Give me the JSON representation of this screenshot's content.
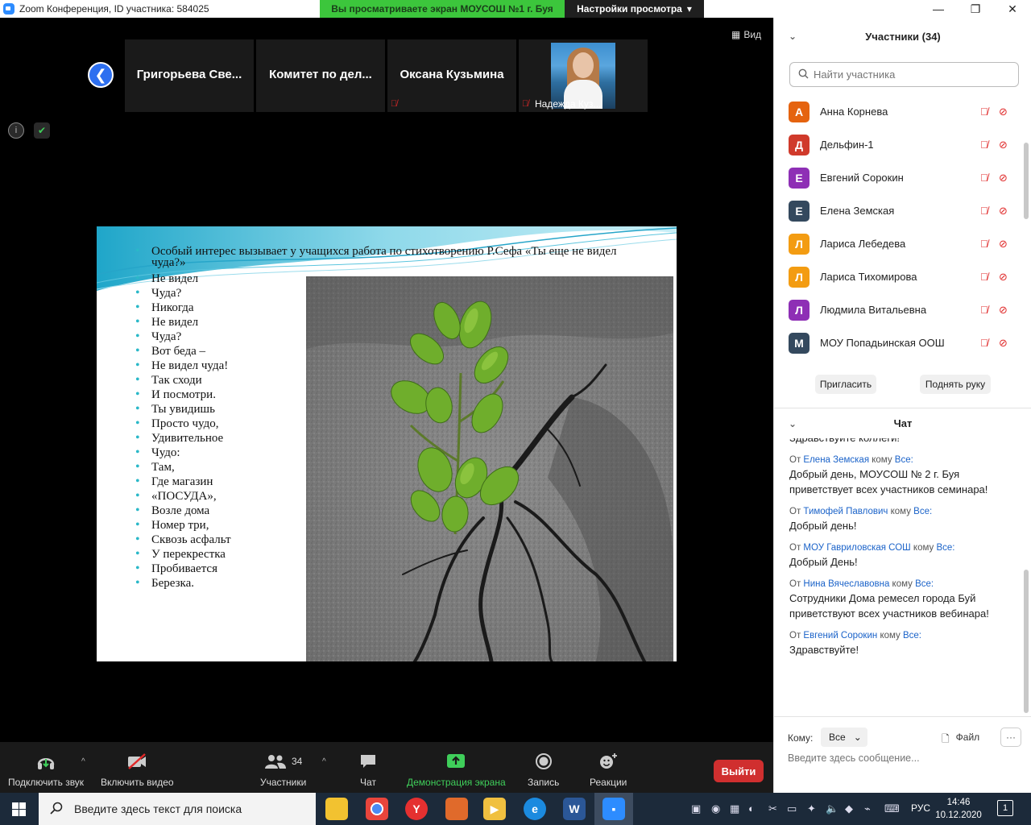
{
  "window": {
    "title": "Zoom Конференция, ID участника: 584025",
    "share_banner": "Вы просматриваете экран МОУСОШ №1 г. Буя",
    "view_settings": "Настройки просмотра",
    "minimize": "—",
    "maximize": "❐",
    "close": "✕"
  },
  "video_strip": {
    "back": "❮",
    "tiles": [
      {
        "name": "Григорьева  Све..."
      },
      {
        "name": "Комитет  по  дел..."
      },
      {
        "name": "Оксана Кузьмина",
        "muted_icon": "mic-muted-icon"
      },
      {
        "name": "Надежда Куз...",
        "muted_icon": "mic-muted-icon"
      }
    ],
    "view_label": "Вид",
    "info": "i",
    "shield": "✔"
  },
  "slide": {
    "intro": "Особый интерес вызывает у учащихся работа по стихотворению Р.Сефа «Ты еще не видел чуда?»",
    "lines": [
      "Не видел",
      "Чуда?",
      "Никогда",
      "Не видел",
      "Чуда?",
      "Вот беда –",
      "Не видел чуда!",
      "Так сходи",
      "И посмотри.",
      "Ты увидишь",
      "Просто чудо,",
      "Удивительное",
      " Чудо:",
      "Там,",
      "Где магазин",
      "«ПОСУДА»,",
      "Возле дома",
      "Номер три,",
      "Сквозь асфальт",
      "У перекрестка",
      "Пробивается",
      "Березка."
    ],
    "colors": {
      "bullet": "#2ab8c8",
      "wave": "#39b6d6"
    }
  },
  "controls": {
    "audio": {
      "label": "Подключить звук",
      "icon": "headphones-icon"
    },
    "video": {
      "label": "Включить видео",
      "icon": "video-off-icon"
    },
    "participants": {
      "label": "Участники",
      "count": "34",
      "icon": "people-icon"
    },
    "chat": {
      "label": "Чат",
      "icon": "chat-bubble-icon"
    },
    "share": {
      "label": "Демонстрация экрана",
      "icon": "share-screen-icon"
    },
    "record": {
      "label": "Запись",
      "icon": "record-icon"
    },
    "reactions": {
      "label": "Реакции",
      "icon": "emoji-plus-icon"
    },
    "leave": "Выйти",
    "caret": "^"
  },
  "participants_panel": {
    "title": "Участники (34)",
    "search_placeholder": "Найти участника",
    "people": [
      {
        "initial": "А",
        "name": "Анна Корнева",
        "color": "#e5630f"
      },
      {
        "initial": "Д",
        "name": "Дельфин-1",
        "color": "#d03a2b"
      },
      {
        "initial": "Е",
        "name": "Евгений Сорокин",
        "color": "#8e2fb5"
      },
      {
        "initial": "Е",
        "name": "Елена Земская",
        "color": "#34495e"
      },
      {
        "initial": "Л",
        "name": "Лариса Лебедева",
        "color": "#f39c12"
      },
      {
        "initial": "Л",
        "name": "Лариса Тихомирова",
        "color": "#f39c12"
      },
      {
        "initial": "Л",
        "name": "Людмила Витальевна",
        "color": "#8e2fb5"
      },
      {
        "initial": "М",
        "name": "МОУ Попадьинская ООШ",
        "color": "#34495e"
      }
    ],
    "invite": "Пригласить",
    "raise_hand": "Поднять руку"
  },
  "chat_panel": {
    "title": "Чат",
    "partial_top": "Здравствуйте коллеги!",
    "messages": [
      {
        "from_label": "От",
        "sender": "Елена Земская",
        "to_label": "кому",
        "to": "Все:",
        "text": "Добрый день, МОУСОШ № 2 г. Буя приветствует всех участников семинара!"
      },
      {
        "from_label": "От",
        "sender": "Тимофей Павлович",
        "to_label": "кому",
        "to": "Все:",
        "text": "Добрый день!"
      },
      {
        "from_label": "От",
        "sender": "МОУ Гавриловская СОШ",
        "to_label": "кому",
        "to": "Все:",
        "text": "Добрый День!"
      },
      {
        "from_label": "От",
        "sender": "Нина Вячеславовна",
        "to_label": "кому",
        "to": "Все:",
        "text": "Сотрудники Дома ремесел города Буй приветствуют всех участников вебинара!"
      },
      {
        "from_label": "От",
        "sender": "Евгений Сорокин",
        "to_label": "кому",
        "to": "Все:",
        "text": "Здравствуйте!"
      }
    ],
    "to_label": "Кому:",
    "to_value": "Все",
    "file": "Файл",
    "more": "···",
    "input_placeholder": "Введите здесь сообщение..."
  },
  "taskbar": {
    "search_placeholder": "Введите здесь текст для поиска",
    "language": "РУС",
    "time": "14:46",
    "date": "10.12.2020",
    "notifications": "1"
  }
}
